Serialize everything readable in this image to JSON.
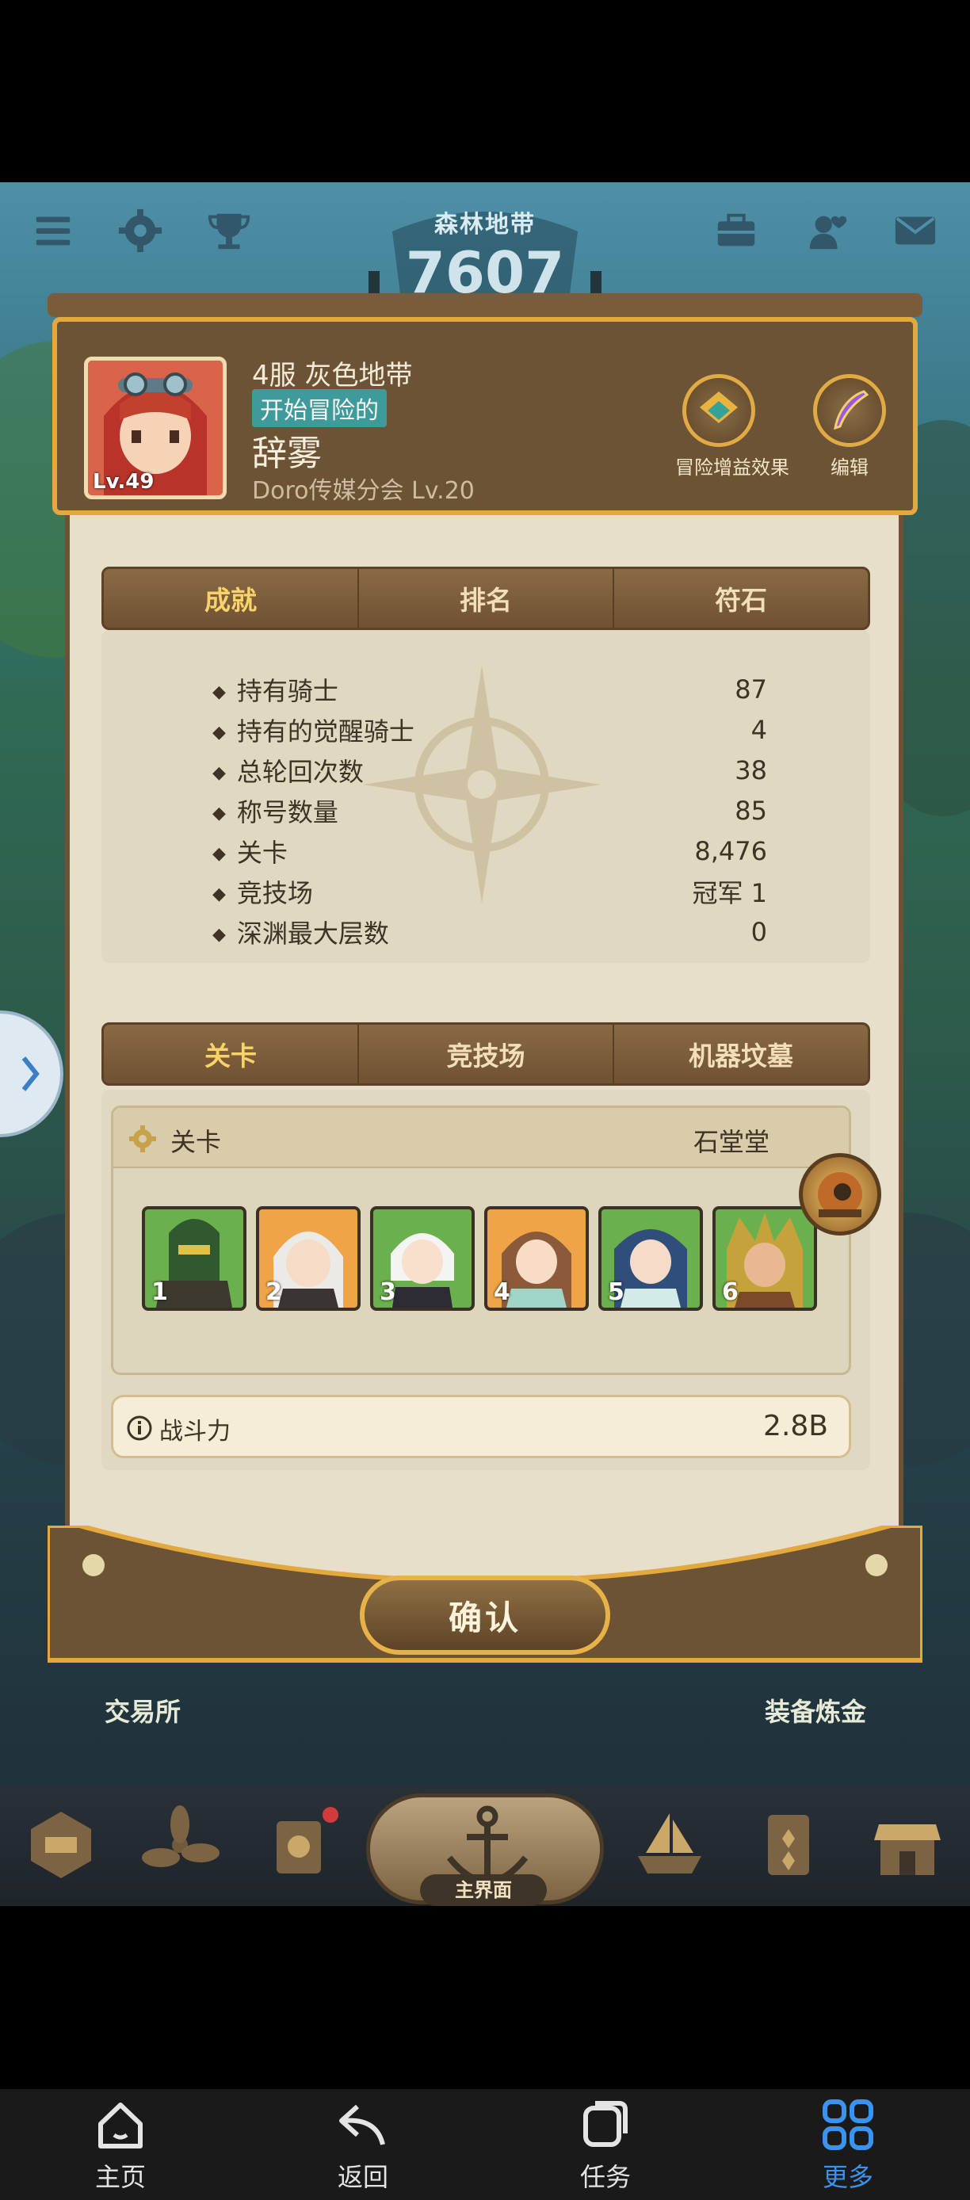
{
  "top_bar": {
    "zone_title": "森林地带",
    "zone_number": "7607"
  },
  "player": {
    "server": "4服 灰色地带",
    "title": "开始冒险的",
    "name": "辞雾",
    "guild": "Doro传媒分会 Lv.20",
    "level": "Lv.49"
  },
  "header_buttons": {
    "buff": "冒险增益效果",
    "edit": "编辑"
  },
  "tabs_top": [
    "成就",
    "排名",
    "符石"
  ],
  "stats": [
    {
      "name": "持有骑士",
      "value": "87"
    },
    {
      "name": "持有的觉醒骑士",
      "value": "4"
    },
    {
      "name": "总轮回次数",
      "value": "38"
    },
    {
      "name": "称号数量",
      "value": "85"
    },
    {
      "name": "关卡",
      "value": "8,476"
    },
    {
      "name": "竞技场",
      "value": "冠军 1"
    },
    {
      "name": "深渊最大层数",
      "value": "0"
    }
  ],
  "tabs_bottom": [
    "关卡",
    "竞技场",
    "机器坟墓"
  ],
  "stage": {
    "label": "关卡",
    "value": "石堂堂",
    "heroes": [
      "1",
      "2",
      "3",
      "4",
      "5",
      "6"
    ]
  },
  "power": {
    "label": "战斗力",
    "value": "2.8B"
  },
  "confirm": "确认",
  "game_labels": {
    "exchange": "交易所",
    "smelt": "装备炼金",
    "main": "主界面"
  },
  "system_nav": [
    "主页",
    "返回",
    "任务",
    "更多"
  ],
  "colors": {
    "accent_gold": "#e3a83e",
    "panel_brown": "#6d5336",
    "paper": "#e7dfc9",
    "title_badge": "#3f9a9c",
    "active_nav": "#3b93f0"
  }
}
